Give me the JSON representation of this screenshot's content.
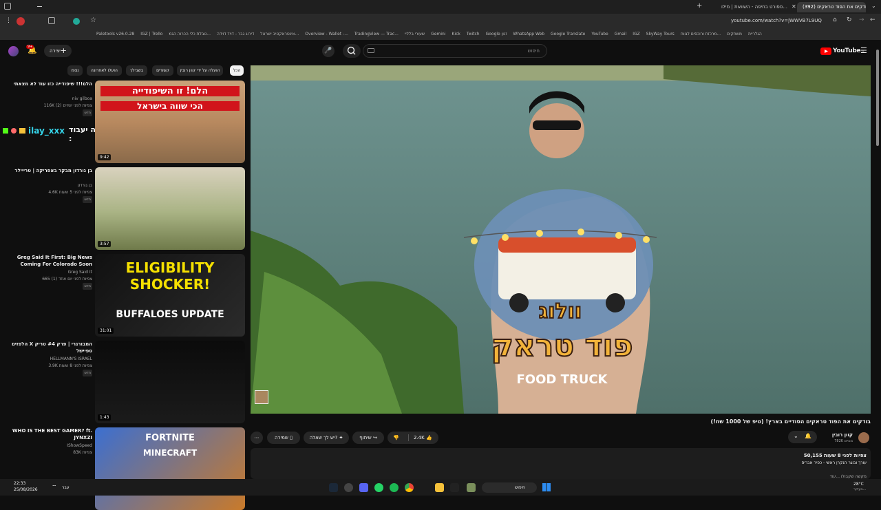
{
  "browser": {
    "tabs": [
      {
        "label": "(392) בודקים את הפוד טראקים",
        "active": true
      },
      {
        "label": "ספורט בחיפה - השוואת | מילו...",
        "active": false
      }
    ],
    "url": "youtube.com/watch?v=jWWVB7L9UQ",
    "bookmarks": [
      "Paletools v26.0.28",
      "IGZ | Trello",
      "טבלת כלי הכרוה הגמ...",
      "דירוג גבר - דויד דוידה",
      "אינטראקטיב ישראל...",
      "Overview - Wallet -...",
      "TradingView — Trac...",
      "שעורי בלליי",
      "Gemini",
      "Kick",
      "Twitch",
      "Google זנון",
      "WhatsApp Web",
      "Google Translate",
      "YouTube",
      "Gmail",
      "IGZ",
      "SkyWay Tours",
      "מרכזת ורוכסים לגווח...",
      "משחקים",
      "הגלריית"
    ]
  },
  "youtube": {
    "logo_text": "YouTube",
    "logo_sup": "IL",
    "search_placeholder": "חיפוש",
    "create_label": "יצירה",
    "notif_count": "9+",
    "chips": [
      "הכל",
      "הועלה על ידי קוון רובין",
      "קשורים",
      "בשבילך",
      "הועלו לאחרונה",
      "נצפו"
    ],
    "video": {
      "title": "בודקים את הפוד טראקים הסודיים בארץ! (טיפ של 1000 שח!)",
      "channel": "קוון רובין",
      "subscribers": "782K מנויים",
      "likes": "2.4K",
      "share_label": "שיתוף",
      "ask_label": "יש לך שאלה?",
      "save_label": "שמירה",
      "views_line": "50,155 צפיות  לפני 8 שעות",
      "desc_line": "עורך ובוגר הנקרן ראשי - כפיר אבריס",
      "more_line": "מקשה שקבולו ...עוד",
      "overlay_title_1": "וולוג",
      "overlay_title_2": "פוד טראק",
      "overlay_title_en": "FOOD TRUCK"
    },
    "related": [
      {
        "title": "הלם!!! שיפודייה כזו עוד לא מצאתי",
        "channel": "niv gilboa",
        "meta": "116K צפיות לפני יומיים (2)",
        "badge": "חדש",
        "duration": "9:42",
        "thumb_text_1": "הלם! זו השיפודייה",
        "thumb_text_2": "הכי שווה בישראל",
        "theme": "red"
      },
      {
        "title": "בן גורדון מבקר באפריקה | טרייילר",
        "channel": "בן גורדון",
        "meta": "4.6K צפיות לפני 5 שעות",
        "badge": "חדש",
        "duration": "3:57",
        "thumb_text_1": "",
        "thumb_text_2": "",
        "theme": "safari"
      },
      {
        "title": "Greg Said It First: Big News Coming For Colorado Soon",
        "channel": "Greg Said It",
        "meta": "665 צפיות לפני יום אחד (1)",
        "badge": "חדש",
        "duration": "31:01",
        "thumb_text_1": "ELIGIBILITY SHOCKER!",
        "thumb_text_2": "BUFFALOES UPDATE",
        "theme": "dark"
      },
      {
        "title": "הלפזים X המבורגרי | פרק #4 טריק ספיישל",
        "channel": "HELLMANN'S ISRAEL",
        "meta": "3.9K צפיות לפני 8 שעות",
        "badge": "חדש",
        "duration": "1:43",
        "thumb_text_1": "",
        "thumb_text_2": "",
        "theme": "black"
      },
      {
        "title": "WHO IS THE BEST GAMER? ft. JYNXZI",
        "channel": "IShowSpeed",
        "meta": "83K צפיות",
        "badge": "",
        "duration": "",
        "thumb_text_1": "FORTNITE",
        "thumb_text_2": "MINECRAFT",
        "theme": "game"
      }
    ],
    "chat_overlay": {
      "user": "ilay_xxx",
      "message": "מיכאל לא בטוח שזה יעבוד :"
    }
  },
  "taskbar": {
    "time": "22:33",
    "date": "25/08/2026",
    "lang": "עבר",
    "search_placeholder": "חיפוש",
    "weather": "28°C",
    "weather_desc": "בעיקר..."
  },
  "colors": {
    "yt_red": "#ff0000",
    "bg": "#0f0f0f",
    "chip": "#272727"
  }
}
